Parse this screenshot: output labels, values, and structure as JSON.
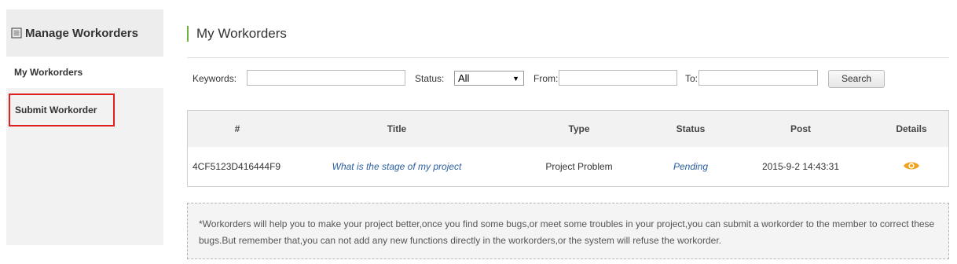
{
  "sidebar": {
    "title": "Manage Workorders",
    "items": [
      {
        "label": "My Workorders"
      },
      {
        "label": "Submit Workorder"
      }
    ]
  },
  "main": {
    "title": "My Workorders"
  },
  "filters": {
    "keywords_label": "Keywords:",
    "keywords_value": "",
    "status_label": "Status:",
    "status_value": "All",
    "from_label": "From:",
    "from_value": "",
    "to_label": "To:",
    "to_value": "",
    "search_label": "Search"
  },
  "table": {
    "headers": [
      "#",
      "Title",
      "Type",
      "Status",
      "Post",
      "Details"
    ],
    "rows": [
      {
        "id": "4CF5123D416444F9",
        "title": "What is the stage of my project",
        "type": "Project Problem",
        "status": "Pending",
        "post": "2015-9-2 14:43:31",
        "details_icon": "eye-icon"
      }
    ]
  },
  "note": {
    "text": "*Workorders will help you to make your project better,once you find some bugs,or meet some troubles in your project,you can submit a workorder to the member to correct these bugs.But remember that,you can not add any new functions directly in the workorders,or the system will refuse the workorder."
  },
  "colors": {
    "accent_green": "#6bb13b",
    "link_blue": "#2a5f9e",
    "highlight_red": "#e02020",
    "eye_orange": "#f0a21e"
  }
}
